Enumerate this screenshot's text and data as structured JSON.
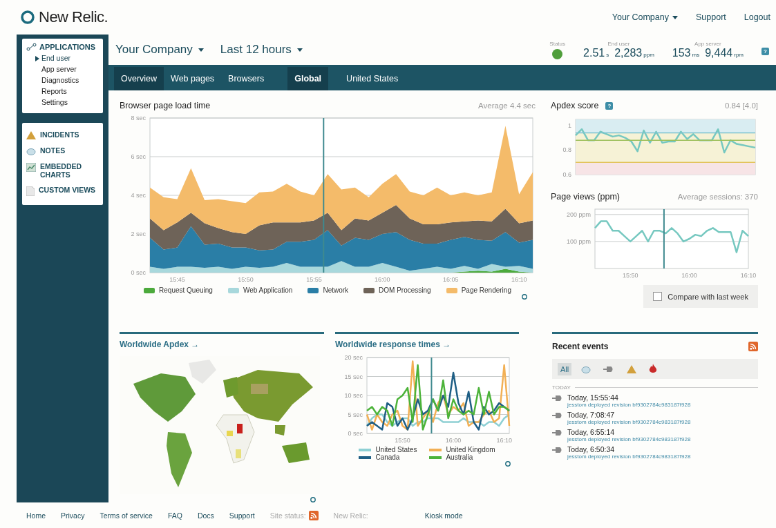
{
  "header": {
    "logo": "New Relic.",
    "links": [
      {
        "label": "Your Company",
        "kind": "dropdown"
      },
      {
        "label": "Support",
        "kind": "link"
      },
      {
        "label": "Logout",
        "kind": "link"
      }
    ]
  },
  "sidebar": {
    "applications": {
      "title": "APPLICATIONS",
      "items": [
        {
          "label": "End user",
          "selected": true
        },
        {
          "label": "App server",
          "selected": false
        },
        {
          "label": "Diagnostics",
          "selected": false
        },
        {
          "label": "Reports",
          "selected": false
        },
        {
          "label": "Settings",
          "selected": false
        }
      ]
    },
    "sections": [
      {
        "label": "INCIDENTS",
        "kind": "incidents"
      },
      {
        "label": "NOTES",
        "kind": "notes"
      },
      {
        "label": "EMBEDDED CHARTS",
        "kind": "charts"
      },
      {
        "label": "CUSTOM VIEWS",
        "kind": "views"
      }
    ]
  },
  "toolbar": {
    "account": "Your Company",
    "range": "Last 12 hours",
    "status": "Status",
    "metrics": [
      {
        "label": "End user",
        "readings": [
          {
            "value": "2.51",
            "unit": "s"
          },
          {
            "value": "2,283",
            "unit": "ppm"
          }
        ]
      },
      {
        "label": "App server",
        "readings": [
          {
            "value": "153",
            "unit": "ms"
          },
          {
            "value": "9,444",
            "unit": "rpm"
          }
        ]
      }
    ],
    "help": "?"
  },
  "tabs": [
    {
      "label": "Overview",
      "selected": true
    },
    {
      "label": "Web pages",
      "selected": false
    },
    {
      "label": "Browsers",
      "selected": false
    }
  ],
  "regions": [
    {
      "label": "Global",
      "selected": true
    },
    {
      "label": "United States",
      "selected": false
    }
  ],
  "load_time": {
    "title": "Browser page load time",
    "average": "Average 4.4 sec",
    "chart_data": {
      "type": "area",
      "stacked": true,
      "categories": [
        null,
        null,
        "15:45",
        null,
        null,
        null,
        null,
        "15:50",
        null,
        null,
        null,
        null,
        "15:55",
        null,
        null,
        null,
        null,
        "16:00",
        null,
        null,
        null,
        null,
        "16:05",
        null,
        null,
        null,
        null,
        "16:10",
        null
      ],
      "ylim": [
        0,
        8
      ],
      "yticks": [
        {
          "value": 0,
          "label": "0 sec"
        },
        {
          "value": 2,
          "label": "2 sec"
        },
        {
          "value": 4,
          "label": "4 sec"
        },
        {
          "value": 6,
          "label": "6 sec"
        },
        {
          "value": 8,
          "label": "8 sec"
        }
      ],
      "series": [
        {
          "name": "Request Queuing",
          "color": "#4caa3c",
          "values": [
            0,
            0,
            0,
            0,
            0,
            0,
            0,
            0,
            0,
            0,
            0,
            0,
            0,
            0,
            0,
            0,
            0,
            0,
            0,
            0,
            0,
            0,
            0,
            0.05,
            0.1,
            0.05,
            0.2,
            0.05,
            0
          ]
        },
        {
          "name": "Web Application",
          "color": "#a8d8dc",
          "values": [
            0.3,
            0.2,
            0.3,
            0.3,
            0.25,
            0.3,
            0.2,
            0.3,
            0.25,
            0.3,
            0.5,
            0.3,
            0.3,
            0.3,
            0.6,
            0.3,
            0.3,
            0.5,
            0.3,
            0.1,
            0.2,
            0.3,
            0.2,
            0.3,
            0.1,
            0.4,
            0.1,
            0.3,
            0.2
          ]
        },
        {
          "name": "Network",
          "color": "#2a7ea6",
          "values": [
            1.5,
            1.0,
            1.0,
            2.1,
            1.2,
            1.2,
            1.1,
            1.0,
            0.9,
            0.9,
            1.1,
            1.3,
            1.4,
            1.9,
            0.8,
            1.5,
            1.4,
            1.5,
            1.8,
            1.6,
            1.3,
            1.2,
            1.5,
            1.5,
            1.5,
            1.2,
            1.8,
            1.2,
            1.5
          ]
        },
        {
          "name": "DOM Processing",
          "color": "#6e6358",
          "values": [
            1.0,
            1.0,
            1.3,
            0.7,
            1.1,
            0.8,
            0.8,
            0.7,
            1.3,
            1.4,
            1.0,
            1.0,
            1.0,
            0.9,
            0.8,
            1.0,
            1.0,
            1.1,
            1.4,
            1.1,
            1.0,
            1.0,
            0.9,
            0.8,
            1.0,
            1.0,
            1.2,
            1.0,
            1.0
          ]
        },
        {
          "name": "Page Rendering",
          "color": "#f4bb6a",
          "values": [
            1.6,
            1.7,
            1.2,
            2.3,
            1.2,
            1.5,
            1.6,
            1.6,
            1.7,
            1.6,
            2.0,
            1.6,
            1.3,
            2.0,
            2.1,
            1.6,
            1.2,
            1.5,
            1.6,
            1.4,
            1.5,
            1.9,
            1.4,
            1.5,
            1.3,
            1.5,
            4.3,
            1.5,
            2.5
          ]
        }
      ],
      "grid": true
    }
  },
  "apdex": {
    "title": "Apdex score",
    "help": "?",
    "score": "0.84 [4.0]",
    "chart_data": {
      "type": "line",
      "ylim": [
        0.6,
        1.05
      ],
      "yticks": [
        0.6,
        0.8,
        1
      ],
      "bands": [
        {
          "axis": "y",
          "from": 0.94,
          "to": 1.05,
          "color": "#d9edf2"
        },
        {
          "axis": "y",
          "from": 0.7,
          "to": 0.94,
          "color": "#f6f2d6"
        },
        {
          "axis": "y",
          "from": 0.6,
          "to": 0.7,
          "color": "#f7e4e6"
        }
      ],
      "ref_lines": [
        {
          "axis": "y",
          "value": 0.94,
          "color": "#7cc3cf"
        },
        {
          "axis": "y",
          "value": 0.88,
          "color": "#9bbf5a"
        },
        {
          "axis": "y",
          "value": 0.7,
          "color": "#e2c35a"
        }
      ],
      "values": [
        0.92,
        0.97,
        0.88,
        0.88,
        0.95,
        0.93,
        0.91,
        0.92,
        0.9,
        0.87,
        0.79,
        0.96,
        0.86,
        0.95,
        0.86,
        0.87,
        0.87,
        0.95,
        0.89,
        0.93,
        0.88,
        0.88,
        0.88,
        0.97,
        0.78,
        0.88,
        0.85,
        0.84,
        0.83,
        0.82
      ]
    }
  },
  "page_views": {
    "title": "Page views (ppm)",
    "average": "Average sessions: 370",
    "chart_data": {
      "type": "line",
      "categories": [
        null,
        null,
        null,
        null,
        null,
        null,
        "15:50",
        null,
        null,
        null,
        null,
        null,
        null,
        null,
        null,
        null,
        "16:00",
        null,
        null,
        null,
        null,
        null,
        null,
        null,
        null,
        null,
        "16:10"
      ],
      "ylim": [
        0,
        220
      ],
      "yticks": [
        {
          "value": 100,
          "label": "100 ppm"
        },
        {
          "value": 200,
          "label": "200 ppm"
        }
      ],
      "values": [
        150,
        175,
        175,
        140,
        140,
        120,
        100,
        120,
        140,
        100,
        140,
        140,
        130,
        150,
        130,
        100,
        110,
        125,
        120,
        140,
        150,
        135,
        135,
        135,
        60,
        140,
        120
      ],
      "grid": true
    }
  },
  "compare": {
    "label": "Compare with last week",
    "checked": false
  },
  "apdex_map": {
    "title": "Worldwide Apdex →"
  },
  "response_times": {
    "title": "Worldwide response times →",
    "chart_data": {
      "type": "line",
      "categories": [
        null,
        null,
        null,
        null,
        null,
        null,
        null,
        "15:50",
        null,
        null,
        null,
        null,
        null,
        null,
        null,
        null,
        null,
        "16:00",
        null,
        null,
        null,
        null,
        null,
        null,
        null,
        null,
        null,
        "16:10",
        null
      ],
      "ylim": [
        0,
        20
      ],
      "yticks": [
        {
          "value": 0,
          "label": "0 sec"
        },
        {
          "value": 5,
          "label": "5 sec"
        },
        {
          "value": 10,
          "label": "10 sec"
        },
        {
          "value": 15,
          "label": "15 sec"
        },
        {
          "value": 20,
          "label": "20 sec"
        }
      ],
      "series": [
        {
          "name": "United States",
          "color": "#8ed0d4",
          "values": [
            2,
            4,
            5,
            5,
            3,
            2,
            3,
            4,
            4,
            2,
            3,
            3,
            4,
            4,
            4,
            3,
            3,
            3,
            3,
            4,
            3,
            3,
            3,
            2,
            3,
            3,
            2,
            4,
            5
          ]
        },
        {
          "name": "United Kingdom",
          "color": "#f2b055",
          "values": [
            5,
            1,
            5,
            3,
            2,
            5,
            6,
            2,
            1,
            19,
            2,
            4,
            6,
            3,
            8,
            10,
            5,
            7,
            6,
            8,
            2,
            3,
            3,
            5,
            6,
            3,
            4,
            18,
            2
          ]
        },
        {
          "name": "Canada",
          "color": "#1f5f85",
          "values": [
            2,
            3,
            2,
            1,
            8,
            7,
            2,
            4,
            1,
            4,
            9,
            5,
            6,
            9,
            6,
            10,
            7,
            16,
            8,
            5,
            11,
            3,
            1,
            7,
            5,
            6,
            8,
            7,
            6
          ]
        },
        {
          "name": "Australia",
          "color": "#4cb33a",
          "values": [
            6,
            7,
            5,
            7,
            6,
            2,
            9,
            10,
            12,
            3,
            18,
            1,
            5,
            9,
            6,
            14,
            4,
            9,
            6,
            5,
            6,
            5,
            12,
            5,
            11,
            5,
            7,
            7,
            6
          ]
        }
      ],
      "grid": true
    }
  },
  "events": {
    "title": "Recent events",
    "filters": [
      {
        "kind": "all",
        "label": "All",
        "selected": true
      },
      {
        "kind": "notes",
        "selected": false
      },
      {
        "kind": "deployments",
        "selected": false
      },
      {
        "kind": "incidents",
        "selected": false
      },
      {
        "kind": "errors",
        "selected": false
      }
    ],
    "group": "TODAY",
    "items": [
      {
        "time": "Today, 15:55:44",
        "detail": "jesstom deployed revision bf9302784c983187f928"
      },
      {
        "time": "Today, 7:08:47",
        "detail": "jesstom deployed revision bf9302784c983187f928"
      },
      {
        "time": "Today, 6:55:14",
        "detail": "jesstom deployed revision bf9302784c983187f928"
      },
      {
        "time": "Today, 6:50:34",
        "detail": "jesstom deployed revision bf9302784c983187f928"
      }
    ]
  },
  "footer": {
    "links": [
      "Home",
      "Privacy",
      "Terms of service",
      "FAQ",
      "Docs",
      "Support"
    ],
    "site_status": "Site status:",
    "brand": "New Relic:",
    "kiosk": "Kiosk mode"
  }
}
